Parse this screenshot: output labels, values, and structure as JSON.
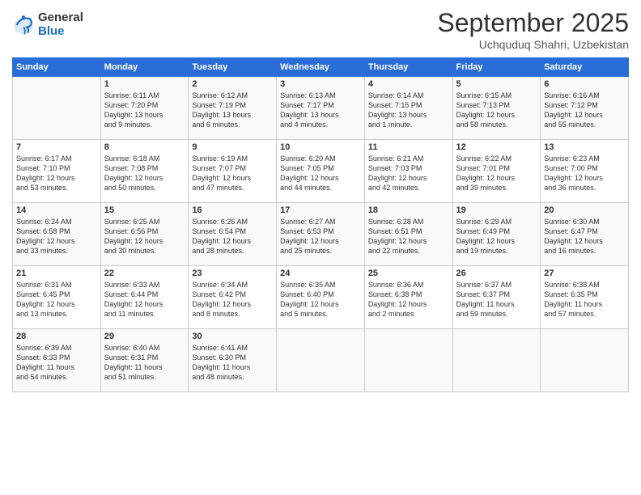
{
  "logo": {
    "general": "General",
    "blue": "Blue"
  },
  "title": "September 2025",
  "location": "Uchquduq Shahri, Uzbekistan",
  "days_of_week": [
    "Sunday",
    "Monday",
    "Tuesday",
    "Wednesday",
    "Thursday",
    "Friday",
    "Saturday"
  ],
  "weeks": [
    [
      {
        "day": "",
        "info": ""
      },
      {
        "day": "1",
        "info": "Sunrise: 6:11 AM\nSunset: 7:20 PM\nDaylight: 13 hours\nand 9 minutes."
      },
      {
        "day": "2",
        "info": "Sunrise: 6:12 AM\nSunset: 7:19 PM\nDaylight: 13 hours\nand 6 minutes."
      },
      {
        "day": "3",
        "info": "Sunrise: 6:13 AM\nSunset: 7:17 PM\nDaylight: 13 hours\nand 4 minutes."
      },
      {
        "day": "4",
        "info": "Sunrise: 6:14 AM\nSunset: 7:15 PM\nDaylight: 13 hours\nand 1 minute."
      },
      {
        "day": "5",
        "info": "Sunrise: 6:15 AM\nSunset: 7:13 PM\nDaylight: 12 hours\nand 58 minutes."
      },
      {
        "day": "6",
        "info": "Sunrise: 6:16 AM\nSunset: 7:12 PM\nDaylight: 12 hours\nand 55 minutes."
      }
    ],
    [
      {
        "day": "7",
        "info": "Sunrise: 6:17 AM\nSunset: 7:10 PM\nDaylight: 12 hours\nand 53 minutes."
      },
      {
        "day": "8",
        "info": "Sunrise: 6:18 AM\nSunset: 7:08 PM\nDaylight: 12 hours\nand 50 minutes."
      },
      {
        "day": "9",
        "info": "Sunrise: 6:19 AM\nSunset: 7:07 PM\nDaylight: 12 hours\nand 47 minutes."
      },
      {
        "day": "10",
        "info": "Sunrise: 6:20 AM\nSunset: 7:05 PM\nDaylight: 12 hours\nand 44 minutes."
      },
      {
        "day": "11",
        "info": "Sunrise: 6:21 AM\nSunset: 7:03 PM\nDaylight: 12 hours\nand 42 minutes."
      },
      {
        "day": "12",
        "info": "Sunrise: 6:22 AM\nSunset: 7:01 PM\nDaylight: 12 hours\nand 39 minutes."
      },
      {
        "day": "13",
        "info": "Sunrise: 6:23 AM\nSunset: 7:00 PM\nDaylight: 12 hours\nand 36 minutes."
      }
    ],
    [
      {
        "day": "14",
        "info": "Sunrise: 6:24 AM\nSunset: 6:58 PM\nDaylight: 12 hours\nand 33 minutes."
      },
      {
        "day": "15",
        "info": "Sunrise: 6:25 AM\nSunset: 6:56 PM\nDaylight: 12 hours\nand 30 minutes."
      },
      {
        "day": "16",
        "info": "Sunrise: 6:26 AM\nSunset: 6:54 PM\nDaylight: 12 hours\nand 28 minutes."
      },
      {
        "day": "17",
        "info": "Sunrise: 6:27 AM\nSunset: 6:53 PM\nDaylight: 12 hours\nand 25 minutes."
      },
      {
        "day": "18",
        "info": "Sunrise: 6:28 AM\nSunset: 6:51 PM\nDaylight: 12 hours\nand 22 minutes."
      },
      {
        "day": "19",
        "info": "Sunrise: 6:29 AM\nSunset: 6:49 PM\nDaylight: 12 hours\nand 19 minutes."
      },
      {
        "day": "20",
        "info": "Sunrise: 6:30 AM\nSunset: 6:47 PM\nDaylight: 12 hours\nand 16 minutes."
      }
    ],
    [
      {
        "day": "21",
        "info": "Sunrise: 6:31 AM\nSunset: 6:45 PM\nDaylight: 12 hours\nand 13 minutes."
      },
      {
        "day": "22",
        "info": "Sunrise: 6:33 AM\nSunset: 6:44 PM\nDaylight: 12 hours\nand 11 minutes."
      },
      {
        "day": "23",
        "info": "Sunrise: 6:34 AM\nSunset: 6:42 PM\nDaylight: 12 hours\nand 8 minutes."
      },
      {
        "day": "24",
        "info": "Sunrise: 6:35 AM\nSunset: 6:40 PM\nDaylight: 12 hours\nand 5 minutes."
      },
      {
        "day": "25",
        "info": "Sunrise: 6:36 AM\nSunset: 6:38 PM\nDaylight: 12 hours\nand 2 minutes."
      },
      {
        "day": "26",
        "info": "Sunrise: 6:37 AM\nSunset: 6:37 PM\nDaylight: 11 hours\nand 59 minutes."
      },
      {
        "day": "27",
        "info": "Sunrise: 6:38 AM\nSunset: 6:35 PM\nDaylight: 11 hours\nand 57 minutes."
      }
    ],
    [
      {
        "day": "28",
        "info": "Sunrise: 6:39 AM\nSunset: 6:33 PM\nDaylight: 11 hours\nand 54 minutes."
      },
      {
        "day": "29",
        "info": "Sunrise: 6:40 AM\nSunset: 6:31 PM\nDaylight: 11 hours\nand 51 minutes."
      },
      {
        "day": "30",
        "info": "Sunrise: 6:41 AM\nSunset: 6:30 PM\nDaylight: 11 hours\nand 48 minutes."
      },
      {
        "day": "",
        "info": ""
      },
      {
        "day": "",
        "info": ""
      },
      {
        "day": "",
        "info": ""
      },
      {
        "day": "",
        "info": ""
      }
    ]
  ]
}
